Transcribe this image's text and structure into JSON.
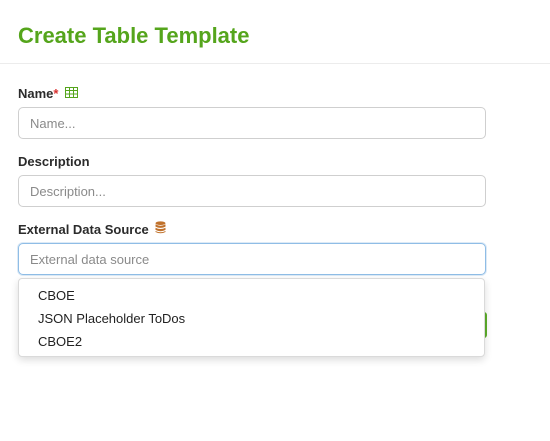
{
  "header": {
    "title": "Create Table Template"
  },
  "form": {
    "name": {
      "label": "Name",
      "required_mark": "*",
      "icon": "table-icon",
      "placeholder": "Name...",
      "value": ""
    },
    "description": {
      "label": "Description",
      "placeholder": "Description...",
      "value": ""
    },
    "external_data_source": {
      "label": "External Data Source",
      "icon": "database-icon",
      "placeholder": "External data source",
      "value": "",
      "options": [
        "CBOE",
        "JSON Placeholder ToDos",
        "CBOE2"
      ]
    }
  },
  "colors": {
    "title_green": "#55a51c",
    "required_red": "#d9302f",
    "database_icon_orange": "#c0712b",
    "focus_border": "#8fbde6"
  }
}
